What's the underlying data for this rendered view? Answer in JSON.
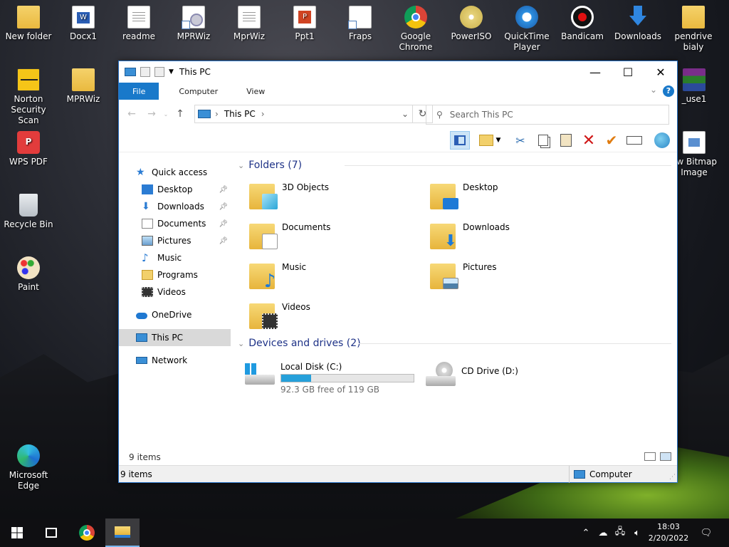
{
  "desktop": {
    "icons": [
      {
        "label": "New folder"
      },
      {
        "label": "Docx1"
      },
      {
        "label": "readme"
      },
      {
        "label": "MPRWiz"
      },
      {
        "label": "MprWiz"
      },
      {
        "label": "Ppt1"
      },
      {
        "label": "Fraps"
      },
      {
        "label": "Google Chrome"
      },
      {
        "label": "PowerISO"
      },
      {
        "label": "QuickTime Player"
      },
      {
        "label": "Bandicam"
      },
      {
        "label": "Downloads"
      },
      {
        "label": "pendrive bialy"
      },
      {
        "label": "Norton Security Scan"
      },
      {
        "label": "MPRWiz"
      },
      {
        "label": "_use1"
      },
      {
        "label": "WPS PDF"
      },
      {
        "label": "ew Bitmap Image"
      },
      {
        "label": "Recycle Bin"
      },
      {
        "label": "Paint"
      },
      {
        "label": "Microsoft Edge"
      }
    ]
  },
  "window": {
    "title": "This PC",
    "controls": {
      "minimize": "—",
      "maximize": "☐",
      "close": "✕"
    },
    "ribbon_tabs": [
      "File",
      "Computer",
      "View"
    ],
    "help": "?",
    "address": {
      "location": "This PC"
    },
    "search_placeholder": "Search This PC",
    "nav": {
      "quick_access": "Quick access",
      "items": [
        {
          "label": "Desktop",
          "pinned": true
        },
        {
          "label": "Downloads",
          "pinned": true
        },
        {
          "label": "Documents",
          "pinned": true
        },
        {
          "label": "Pictures",
          "pinned": true
        },
        {
          "label": "Music",
          "pinned": false
        },
        {
          "label": "Programs",
          "pinned": false
        },
        {
          "label": "Videos",
          "pinned": false
        }
      ],
      "onedrive": "OneDrive",
      "this_pc": "This PC",
      "network": "Network"
    },
    "folders_header": "Folders (7)",
    "folders": [
      "3D Objects",
      "Desktop",
      "Documents",
      "Downloads",
      "Music",
      "Pictures",
      "Videos"
    ],
    "devices_header": "Devices and drives (2)",
    "drives": [
      {
        "name": "Local Disk (C:)",
        "free_text": "92.3 GB free of 119 GB",
        "used_fraction": 0.224
      },
      {
        "name": "CD Drive (D:)"
      }
    ],
    "item_count": "9 items",
    "statusbar": {
      "left": "9 items",
      "right": "Computer"
    }
  },
  "taskbar": {
    "time": "18:03",
    "date": "2/20/2022"
  }
}
